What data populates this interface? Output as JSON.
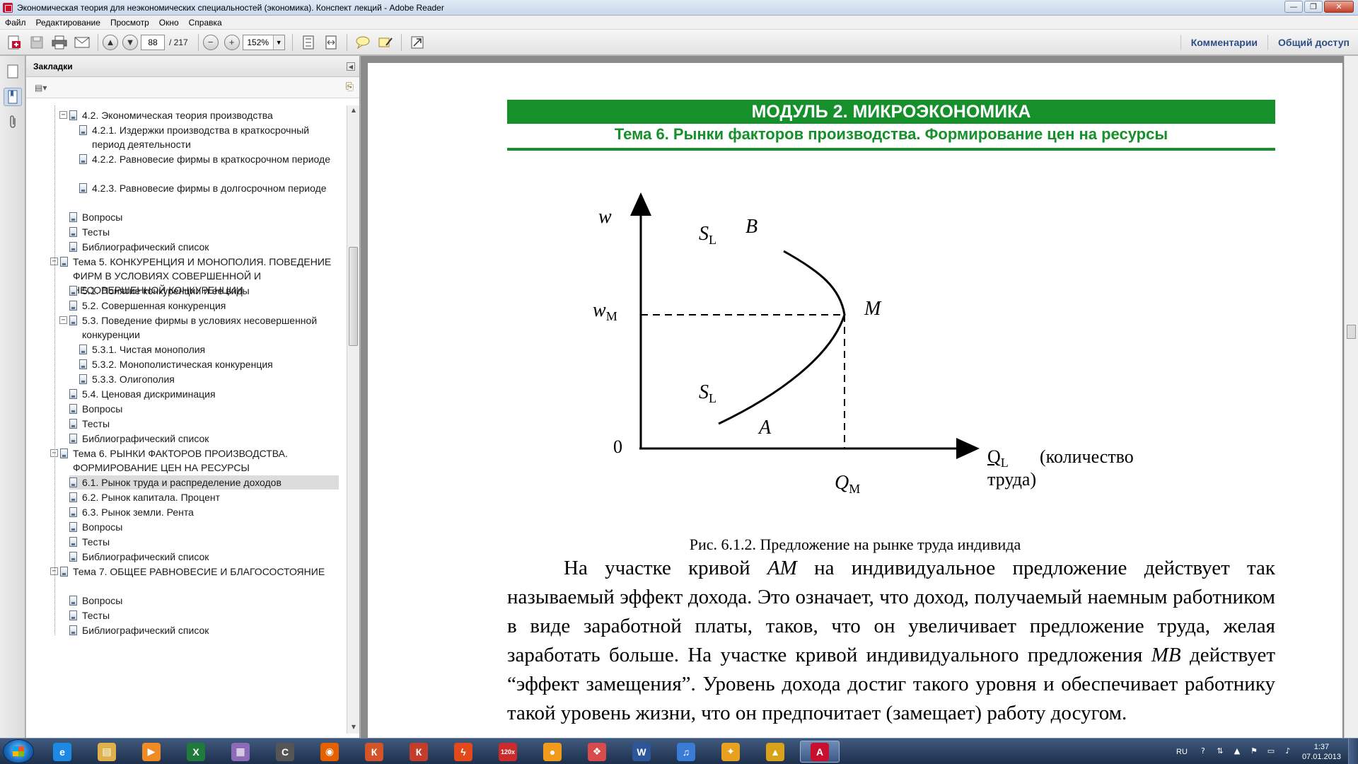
{
  "window": {
    "title": "Экономическая теория для неэкономических специальностей (экономика). Конспект лекций - Adobe Reader",
    "controls": [
      "—",
      "❐",
      "✕"
    ]
  },
  "menu": [
    "Файл",
    "Редактирование",
    "Просмотр",
    "Окно",
    "Справка"
  ],
  "toolbar": {
    "page_current": "88",
    "page_total": "/ 217",
    "zoom": "152%",
    "comments_label": "Комментарии",
    "share_label": "Общий доступ",
    "icons": [
      "create-pdf-icon",
      "save-icon",
      "print-icon",
      "email-icon",
      "prev-page-icon",
      "next-page-icon",
      "zoom-out-icon",
      "zoom-in-icon",
      "fit-page-icon",
      "fit-width-icon",
      "comment-icon",
      "highlight-icon",
      "fullscreen-icon"
    ]
  },
  "bookmarks": {
    "title": "Закладки",
    "items": [
      {
        "text": "4.2. Экономическая теория производства",
        "level": 1,
        "expanded": true
      },
      {
        "text": "4.2.1. Издержки производства в краткосрочный период деятельности",
        "level": 2
      },
      {
        "text": "4.2.2. Равновесие фирмы в краткосрочном периоде",
        "level": 2
      },
      {
        "text": "4.2.3. Равновесие фирмы в долгосрочном периоде",
        "level": 2
      },
      {
        "text": "Вопросы",
        "level": 1
      },
      {
        "text": "Тесты",
        "level": 1
      },
      {
        "text": "Библиографический список",
        "level": 1
      },
      {
        "text": "Тема 5. КОНКУРЕНЦИЯ И МОНОПОЛИЯ. ПОВЕДЕНИЕ ФИРМ  В  УСЛОВИЯХ  СОВЕРШЕННОЙ  И НЕСОВЕРШЕННОЙ  КОНКУРЕНЦИИ",
        "level": 0,
        "expanded": true
      },
      {
        "text": "5.1. Понятие конкуренции и ее виды",
        "level": 1
      },
      {
        "text": "5.2. Совершенная конкуренция",
        "level": 1
      },
      {
        "text": "5.3. Поведение фирмы в условиях несовершенной конкуренции",
        "level": 1,
        "expanded": true
      },
      {
        "text": "5.3.1. Чистая монополия",
        "level": 2
      },
      {
        "text": "5.3.2. Монополистическая конкуренция",
        "level": 2
      },
      {
        "text": "5.3.3. Олигополия",
        "level": 2
      },
      {
        "text": "5.4. Ценовая дискриминация",
        "level": 1
      },
      {
        "text": "Вопросы",
        "level": 1
      },
      {
        "text": "Тесты",
        "level": 1
      },
      {
        "text": "Библиографический список",
        "level": 1
      },
      {
        "text": "Тема 6. РЫНКИ ФАКТОРОВ  ПРОИЗВОДСТВА. ФОРМИРОВАНИЕ  ЦЕН  НА  РЕСУРСЫ",
        "level": 0,
        "expanded": true
      },
      {
        "text": "6.1. Рынок труда и распределение доходов",
        "level": 1,
        "selected": true
      },
      {
        "text": "6.2. Рынок капитала. Процент",
        "level": 1
      },
      {
        "text": "6.3. Рынок земли. Рента",
        "level": 1
      },
      {
        "text": "Вопросы",
        "level": 1
      },
      {
        "text": "Тесты",
        "level": 1
      },
      {
        "text": "Библиографический список",
        "level": 1
      },
      {
        "text": "Тема 7. ОБЩЕЕ  РАВНОВЕСИЕ  И  БЛАГОСОСТОЯНИЕ",
        "level": 0,
        "expanded": true
      },
      {
        "text": "Вопросы",
        "level": 1
      },
      {
        "text": "Тесты",
        "level": 1
      },
      {
        "text": "Библиографический список",
        "level": 1
      }
    ]
  },
  "document": {
    "header_module": "МОДУЛЬ 2. МИКРОЭКОНОМИКА",
    "header_topic": "Тема 6.  Рынки факторов  производства. Формирование   цен  на  ресурсы",
    "graph": {
      "y_axis_label": "w",
      "wm_main": "w",
      "wm_sub": "M",
      "origin_label": "0",
      "sl_top_main": "S",
      "sl_top_sub": "L",
      "sl_bottom_main": "S",
      "sl_bottom_sub": "L",
      "point_b": "B",
      "point_m": "M",
      "point_a": "A",
      "ql_main": "Q",
      "ql_sub": "L",
      "ql_desc_1": "(количество",
      "ql_desc_2": "труда)",
      "qm_main": "Q",
      "qm_sub": "M"
    },
    "caption": "Рис. 6.1.2. Предложение на рынке труда индивида",
    "paragraph": {
      "p1": "На участке кривой ",
      "am": "AM",
      "p2": " на индивидуальное предложение действует так называемый эффект дохода. Это означает, что доход, получаемый наемным работником в виде заработной платы, таков, что он увеличивает предложение труда, желая заработать больше. На участке кривой индивидуального предложения ",
      "mb": "MB",
      "p3": " действует “эффект замещения”. Уровень дохода достиг такого уровня и обеспечивает работнику такой уровень жизни, что он предпочитает (замещает) работу досугом."
    }
  },
  "taskbar": {
    "apps": [
      {
        "name": "ie",
        "label": "e",
        "color": "#1e88e5"
      },
      {
        "name": "explorer",
        "label": "▤",
        "color": "#e0b04a"
      },
      {
        "name": "media",
        "label": "▶",
        "color": "#f08a24"
      },
      {
        "name": "excel",
        "label": "X",
        "color": "#1f7a3c"
      },
      {
        "name": "archive",
        "label": "▦",
        "color": "#8e6bb8"
      },
      {
        "name": "terminal",
        "label": "C",
        "color": "#555555"
      },
      {
        "name": "firefox",
        "label": "◉",
        "color": "#e66000"
      },
      {
        "name": "kmp",
        "label": "К",
        "color": "#d3542b"
      },
      {
        "name": "k-lite",
        "label": "К",
        "color": "#c43d2a"
      },
      {
        "name": "flash",
        "label": "ϟ",
        "color": "#e24a1b"
      },
      {
        "name": "imgview",
        "label": "120x",
        "color": "#cc2b2b"
      },
      {
        "name": "bubble",
        "label": "●",
        "color": "#f29a1b"
      },
      {
        "name": "gallery",
        "label": "❖",
        "color": "#d94b4b"
      },
      {
        "name": "word",
        "label": "W",
        "color": "#2b579a"
      },
      {
        "name": "music",
        "label": "♫",
        "color": "#3a7bd5"
      },
      {
        "name": "tools",
        "label": "✦",
        "color": "#e8a020"
      },
      {
        "name": "cursor",
        "label": "▲",
        "color": "#d8a21a"
      },
      {
        "name": "acrobat",
        "label": "A",
        "color": "#c8102e"
      }
    ],
    "lang": "RU",
    "time": "1:37",
    "date": "07.01.2013"
  }
}
